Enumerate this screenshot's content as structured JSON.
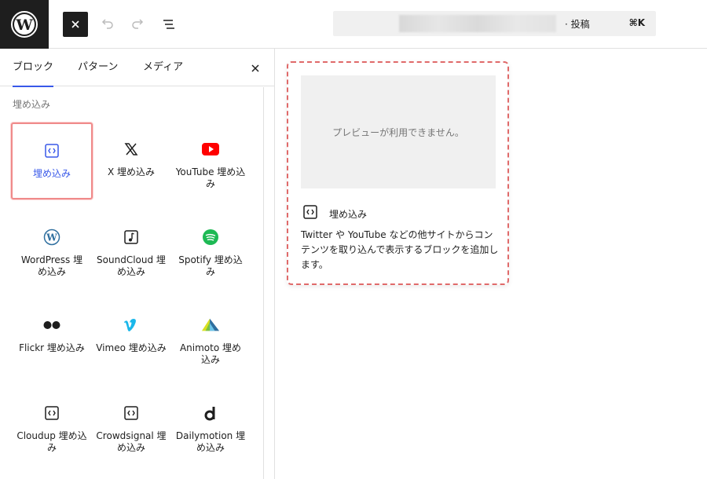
{
  "topbar": {
    "logo_icon": "wordpress-logo-icon",
    "close_icon": "close-icon",
    "undo_icon": "undo-icon",
    "redo_icon": "redo-icon",
    "list_view_icon": "list-view-icon",
    "command": {
      "post_type": "· 投稿",
      "shortcut": "⌘K"
    }
  },
  "sidebar": {
    "tabs": [
      {
        "label": "ブロック",
        "active": true
      },
      {
        "label": "パターン",
        "active": false
      },
      {
        "label": "メディア",
        "active": false
      }
    ],
    "section_title": "埋め込み",
    "blocks": [
      {
        "label": "埋め込み",
        "icon": "embed-icon",
        "selected": true
      },
      {
        "label": "X 埋め込み",
        "icon": "x-logo-icon"
      },
      {
        "label": "YouTube 埋め込み",
        "icon": "youtube-icon"
      },
      {
        "label": "WordPress 埋め込み",
        "icon": "wordpress-icon"
      },
      {
        "label": "SoundCloud 埋め込み",
        "icon": "soundcloud-icon"
      },
      {
        "label": "Spotify 埋め込み",
        "icon": "spotify-icon"
      },
      {
        "label": "Flickr 埋め込み",
        "icon": "flickr-icon"
      },
      {
        "label": "Vimeo 埋め込み",
        "icon": "vimeo-icon"
      },
      {
        "label": "Animoto 埋め込み",
        "icon": "animoto-icon"
      },
      {
        "label": "Cloudup 埋め込み",
        "icon": "embed-icon"
      },
      {
        "label": "Crowdsignal 埋め込み",
        "icon": "embed-icon"
      },
      {
        "label": "Dailymotion 埋め込み",
        "icon": "dailymotion-icon"
      }
    ]
  },
  "preview": {
    "placeholder": "プレビューが利用できません。",
    "title": "埋め込み",
    "description": "Twitter や YouTube などの他サイトからコンテンツを取り込んで表示するブロックを追加します。"
  },
  "colors": {
    "accent": "#3858e9",
    "highlight": "#e06a6a",
    "dark": "#1e1e1e"
  }
}
